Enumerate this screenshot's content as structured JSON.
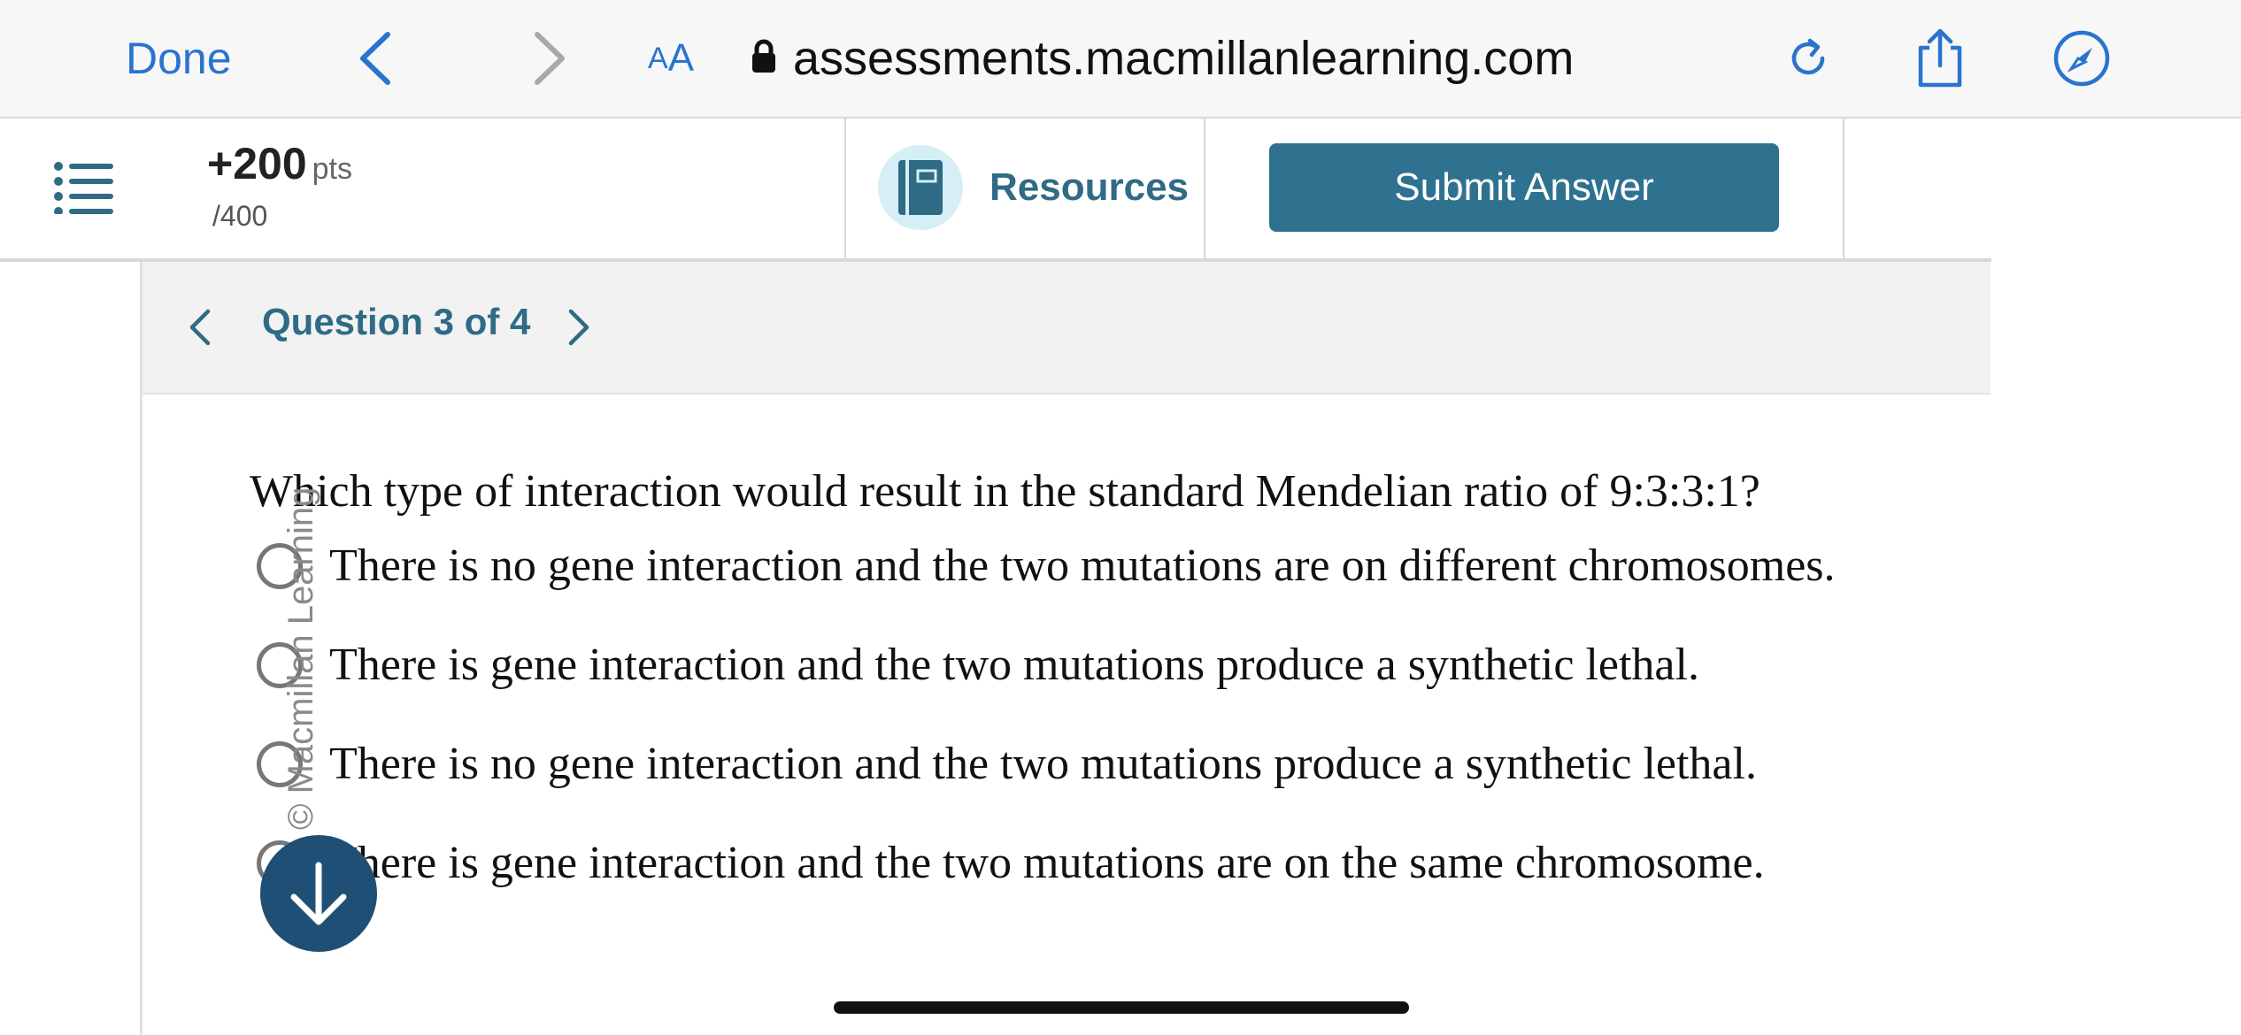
{
  "browser": {
    "done_label": "Done",
    "text_size_label_small": "A",
    "text_size_label_large": "A",
    "url": "assessments.macmillanlearning.com",
    "icons": [
      "back-chevron-icon",
      "forward-chevron-icon",
      "lock-icon",
      "reload-icon",
      "share-icon",
      "compass-icon"
    ]
  },
  "header": {
    "points": "+200",
    "points_unit": "pts",
    "points_total": "/400",
    "resources_label": "Resources",
    "submit_label": "Submit Answer",
    "accent_color": "#2f7290"
  },
  "question_nav": {
    "label": "Question 3 of 4"
  },
  "question": {
    "prompt": "Which type of interaction would result in the standard Mendelian ratio of 9:3:3:1?",
    "choices": [
      "There is no gene interaction and the two mutations are on different chromosomes.",
      "There is gene interaction and the two mutations produce a synthetic lethal.",
      "There is no gene interaction and the two mutations produce a synthetic lethal.",
      "There is gene interaction and the two mutations are on the same chromosome."
    ]
  },
  "watermark": "© Macmillan Learning"
}
